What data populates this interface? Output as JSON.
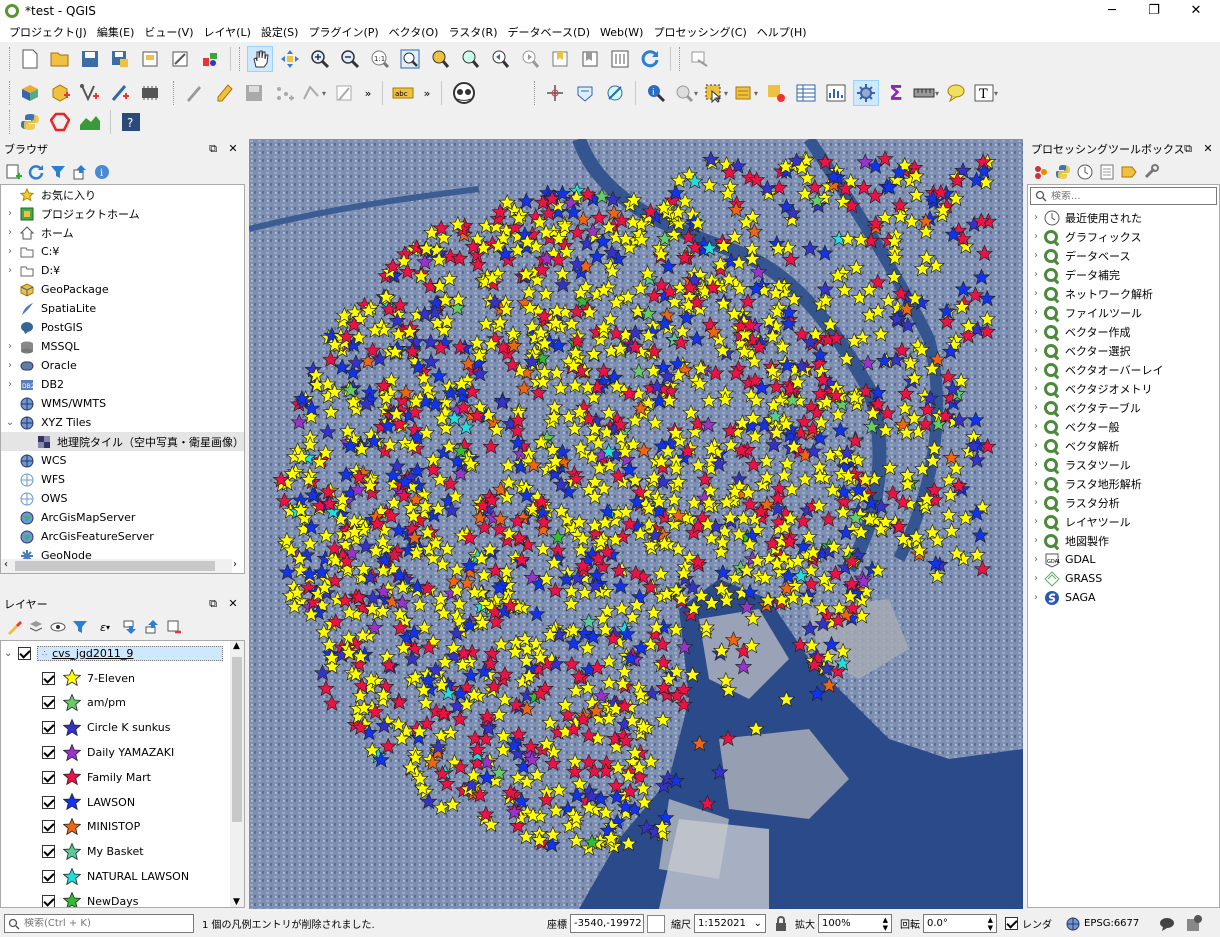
{
  "window": {
    "title": "*test - QGIS",
    "minimize": "─",
    "maximize": "❐",
    "close": "✕"
  },
  "menu": [
    "プロジェクト(J)",
    "編集(E)",
    "ビュー(V)",
    "レイヤ(L)",
    "設定(S)",
    "プラグイン(P)",
    "ベクタ(O)",
    "ラスタ(R)",
    "データベース(D)",
    "Web(W)",
    "プロセッシング(C)",
    "ヘルプ(H)"
  ],
  "browser": {
    "title": "ブラウザ",
    "items": [
      {
        "label": "お気に入り",
        "icon": "star-icon",
        "arrow": ""
      },
      {
        "label": "プロジェクトホーム",
        "icon": "project-home-icon",
        "arrow": "›"
      },
      {
        "label": "ホーム",
        "icon": "home-icon",
        "arrow": "›"
      },
      {
        "label": "C:¥",
        "icon": "folder-icon",
        "arrow": "›"
      },
      {
        "label": "D:¥",
        "icon": "folder-icon",
        "arrow": "›"
      },
      {
        "label": "GeoPackage",
        "icon": "geopackage-icon",
        "arrow": ""
      },
      {
        "label": "SpatiaLite",
        "icon": "spatialite-icon",
        "arrow": ""
      },
      {
        "label": "PostGIS",
        "icon": "postgis-icon",
        "arrow": ""
      },
      {
        "label": "MSSQL",
        "icon": "mssql-icon",
        "arrow": "›"
      },
      {
        "label": "Oracle",
        "icon": "oracle-icon",
        "arrow": "›"
      },
      {
        "label": "DB2",
        "icon": "db2-icon",
        "arrow": "›"
      },
      {
        "label": "WMS/WMTS",
        "icon": "wms-icon",
        "arrow": ""
      },
      {
        "label": "XYZ Tiles",
        "icon": "xyz-tiles-icon",
        "arrow": "⌄"
      },
      {
        "label": "地理院タイル（空中写真・衛星画像）",
        "icon": "tile-layer-icon",
        "arrow": "",
        "child": true
      },
      {
        "label": "WCS",
        "icon": "wcs-icon",
        "arrow": ""
      },
      {
        "label": "WFS",
        "icon": "wfs-icon",
        "arrow": ""
      },
      {
        "label": "OWS",
        "icon": "ows-icon",
        "arrow": ""
      },
      {
        "label": "ArcGisMapServer",
        "icon": "arcgis-map-icon",
        "arrow": ""
      },
      {
        "label": "ArcGisFeatureServer",
        "icon": "arcgis-feature-icon",
        "arrow": ""
      },
      {
        "label": "GeoNode",
        "icon": "geonode-icon",
        "arrow": ""
      }
    ]
  },
  "layers": {
    "title": "レイヤー",
    "group": "cvs_jgd2011_9",
    "items": [
      {
        "label": "7-Eleven",
        "color": "#ffff00"
      },
      {
        "label": "am/pm",
        "color": "#66cc66"
      },
      {
        "label": "Circle K sunkus",
        "color": "#3333cc"
      },
      {
        "label": "Daily YAMAZAKI",
        "color": "#9933cc"
      },
      {
        "label": "Family Mart",
        "color": "#ee1144"
      },
      {
        "label": "LAWSON",
        "color": "#1133ee"
      },
      {
        "label": "MINISTOP",
        "color": "#ee6611"
      },
      {
        "label": "My Basket",
        "color": "#55cc99"
      },
      {
        "label": "NATURAL LAWSON",
        "color": "#22dddd"
      },
      {
        "label": "NewDays",
        "color": "#33bb33"
      }
    ]
  },
  "processing": {
    "title": "プロセッシングツールボックス",
    "search_placeholder": "検索...",
    "items": [
      {
        "label": "最近使用された",
        "icon": "clock-icon"
      },
      {
        "label": "グラフィックス",
        "icon": "qgis-icon"
      },
      {
        "label": "データベース",
        "icon": "qgis-icon"
      },
      {
        "label": "データ補完",
        "icon": "qgis-icon"
      },
      {
        "label": "ネットワーク解析",
        "icon": "qgis-icon"
      },
      {
        "label": "ファイルツール",
        "icon": "qgis-icon"
      },
      {
        "label": "ベクター作成",
        "icon": "qgis-icon"
      },
      {
        "label": "ベクター選択",
        "icon": "qgis-icon"
      },
      {
        "label": "ベクタオーバーレイ",
        "icon": "qgis-icon"
      },
      {
        "label": "ベクタジオメトリ",
        "icon": "qgis-icon"
      },
      {
        "label": "ベクタテーブル",
        "icon": "qgis-icon"
      },
      {
        "label": "ベクター般",
        "icon": "qgis-icon"
      },
      {
        "label": "ベクタ解析",
        "icon": "qgis-icon"
      },
      {
        "label": "ラスタツール",
        "icon": "qgis-icon"
      },
      {
        "label": "ラスタ地形解析",
        "icon": "qgis-icon"
      },
      {
        "label": "ラスタ分析",
        "icon": "qgis-icon"
      },
      {
        "label": "レイヤツール",
        "icon": "qgis-icon"
      },
      {
        "label": "地図製作",
        "icon": "qgis-icon"
      },
      {
        "label": "GDAL",
        "icon": "gdal-icon"
      },
      {
        "label": "GRASS",
        "icon": "grass-icon"
      },
      {
        "label": "SAGA",
        "icon": "saga-icon"
      }
    ]
  },
  "status": {
    "search_placeholder": "検索(Ctrl + K)",
    "message": "1 個の凡例エントリが削除されました.",
    "coord_label": "座標",
    "coord_value": "-3540,-19972",
    "scale_label": "縮尺",
    "scale_value": "1:152021",
    "zoom_label": "拡大",
    "zoom_value": "100%",
    "rotation_label": "回転",
    "rotation_value": "0.0°",
    "render_label": "レンダ",
    "crs": "EPSG:6677"
  }
}
